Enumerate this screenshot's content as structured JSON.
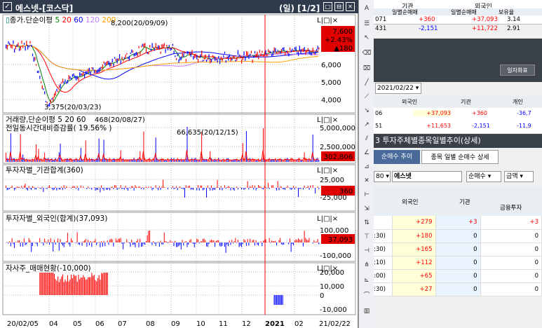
{
  "window": {
    "title": "에스넷-[코스닥]",
    "mode": "(일) [1/2]",
    "buttons": [
      "□",
      "⊟",
      "✕"
    ]
  },
  "price_panel": {
    "title_prefix": "종가.단순이평",
    "ma": [
      {
        "label": "5",
        "color": "#008000"
      },
      {
        "label": "20",
        "color": "#ff0000"
      },
      {
        "label": "60",
        "color": "#0000ff"
      },
      {
        "label": "120",
        "color": "#c080ff"
      },
      {
        "label": "200",
        "color": "#ffa000"
      }
    ],
    "high_label": "8,200(20/09/09)",
    "low_label": "3,375(20/03/23)",
    "price_box": {
      "price": "7,600",
      "pct": "+2.43%",
      "change": "▲180"
    },
    "ticks": [
      "6,000",
      "5,000",
      "4,000"
    ],
    "ctrl": "L|□|×"
  },
  "volume_panel": {
    "title": "거래량,단순이평 5 20 60",
    "subtitle": "전일동시간대비증감률( 19.56% )",
    "peak1": "468(20/08/27)",
    "peak2": "66,635(20/12/15)",
    "box": "302,806",
    "ticks": [
      "5,000,000",
      "2,500,000"
    ],
    "ctrl": "L|□|×"
  },
  "inst_panel": {
    "title": "투자자별_기관합계(360)",
    "box": "360",
    "ticks": [
      "25,000",
      "-25,000"
    ],
    "ctrl": "L|□|×"
  },
  "foreign_panel": {
    "title": "투자자별_외국인(합계)(37,093)",
    "box": "37,093",
    "ticks": [
      "100,000",
      "-100,000"
    ],
    "ctrl": "L|□|×"
  },
  "treasury_panel": {
    "title": "자사주_매매현황(-10,000)",
    "ticks": [
      "20,000",
      "10,000",
      "0",
      "-10,000"
    ],
    "ctrl": "L|□|×"
  },
  "x_axis": {
    "labels": [
      "20/02/05",
      "04",
      "05",
      "06",
      "07",
      "08",
      "09",
      "10",
      "11",
      "12",
      "2021",
      "02",
      "21/02/22"
    ]
  },
  "right_panel": {
    "top_headers": [
      "기관",
      "외국인"
    ],
    "top_sub": [
      "일별순매매",
      "일별순매매",
      "보유율"
    ],
    "top_rows": [
      [
        "071",
        "+360",
        "+37,093",
        "3.14"
      ],
      [
        "431",
        "-2,151",
        "+11,722",
        "2.91"
      ]
    ],
    "bar_button": "일자화표",
    "date": "2021/02/22",
    "mid_headers": [
      "외국인",
      "기관",
      "개인"
    ],
    "mid_rows": [
      [
        "06",
        "+37,093",
        "+360",
        "-36,7"
      ],
      [
        "51",
        "+11,653",
        "-2,151",
        "-11,9"
      ]
    ],
    "section_title": "3  투자주체별종목일별추이(상세)",
    "tabs": [
      "순매수 추이",
      "종목 일별 순매수 상세"
    ],
    "stock_code": "80",
    "stock_name": "에스넷",
    "sel1": "순매수",
    "sel2": "금액",
    "table_headers": [
      "외국인",
      "기관",
      "금융투자"
    ],
    "table_rows": [
      [
        "",
        "+279",
        "+3",
        "+3"
      ],
      [
        ":30)",
        "+180",
        "0",
        "0"
      ],
      [
        ":30)",
        "+165",
        "0",
        "0"
      ],
      [
        ":10)",
        "+112",
        "0",
        "0"
      ],
      [
        ":00)",
        "+65",
        "0",
        "0"
      ],
      [
        ":30)",
        "+27",
        "0",
        "0"
      ]
    ]
  },
  "colors": {
    "up": "#ff0000",
    "down": "#0000ff",
    "titlebar": "#2f3a4d"
  }
}
